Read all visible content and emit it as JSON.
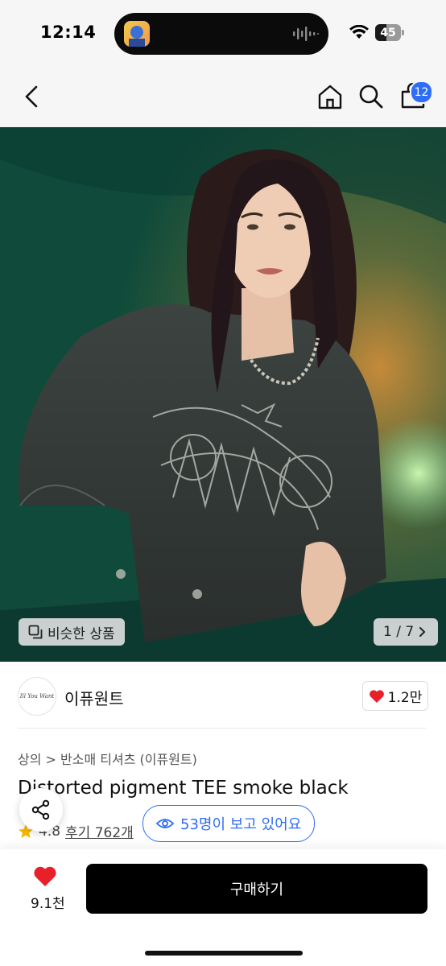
{
  "status_bar": {
    "time": "12:14",
    "battery": "45",
    "battery_level": 0.45
  },
  "header": {
    "cart_count": "12"
  },
  "gallery": {
    "similar_label": "비슷한 상품",
    "counter": "1 / 7"
  },
  "brand": {
    "logo_text": "Ill You Want",
    "name": "이퓨원트",
    "likes": "1.2만"
  },
  "product": {
    "breadcrumb": "상의 > 반소매 티셔츠 (이퓨원트)",
    "title": "Distorted pigment TEE smoke black",
    "rating": "4.8",
    "reviews": "후기 762개",
    "viewers": "53명이 보고 있어요"
  },
  "bottom": {
    "wish_count": "9.1천",
    "buy_label": "구매하기"
  },
  "colors": {
    "accent": "#2f6df6",
    "heart": "#e8202a",
    "star": "#f5b800",
    "photo_bg": "#14503f"
  }
}
